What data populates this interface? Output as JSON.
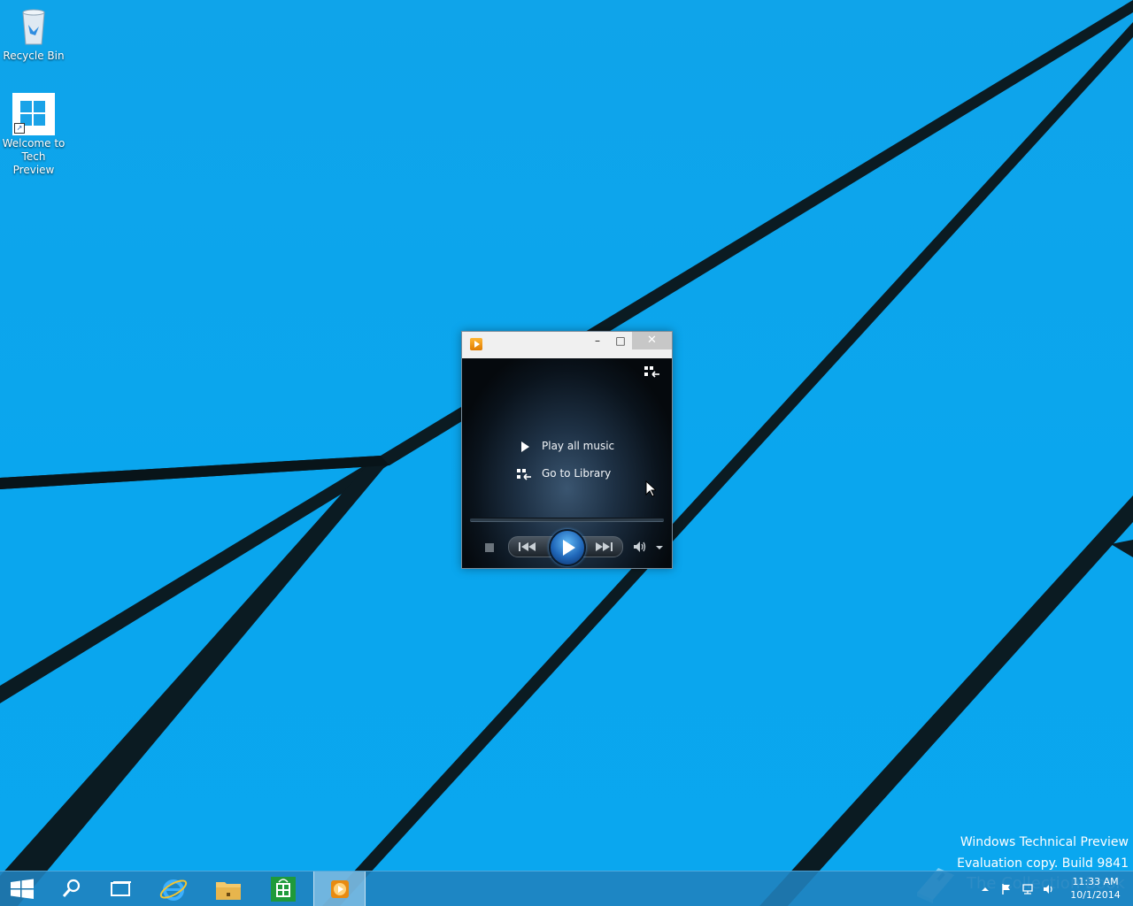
{
  "desktop": {
    "background_color": "#0aa6ee",
    "line_color": "#0b1b22",
    "icons": [
      {
        "label_line1": "Recycle Bin",
        "label_line2": ""
      },
      {
        "label_line1": "Welcome to",
        "label_line2": "Tech Preview"
      }
    ]
  },
  "player": {
    "title": "",
    "window_controls": {
      "minimize": "–",
      "maximize": "□",
      "close": "✕"
    },
    "links": {
      "play_all": "Play all music",
      "go_library": "Go to Library"
    },
    "controls": [
      "stop",
      "previous",
      "play",
      "next",
      "mute",
      "volume"
    ],
    "accent": "#1f66b8"
  },
  "watermark": {
    "line1": "Windows Technical Preview",
    "line2": "Evaluation copy. Build 9841",
    "overlay": "The Collection Book"
  },
  "taskbar": {
    "apps": [
      "start",
      "search",
      "task-view",
      "internet-explorer",
      "file-explorer",
      "store",
      "windows-media-player"
    ],
    "clock_time": "11:33 AM",
    "clock_date": "10/1/2014"
  }
}
